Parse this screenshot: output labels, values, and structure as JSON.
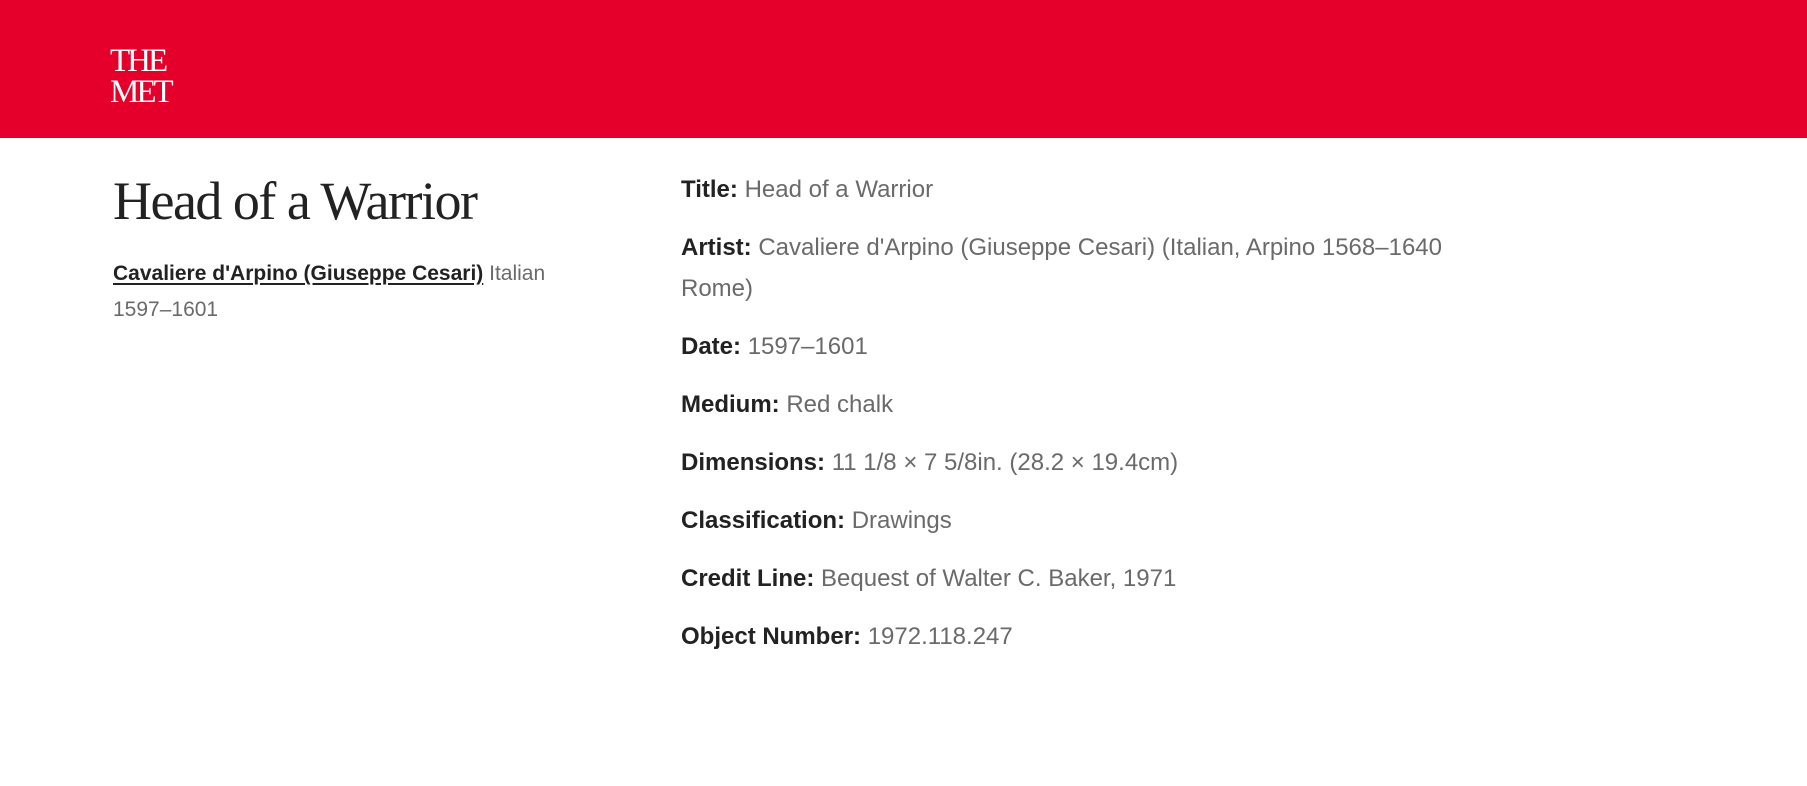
{
  "header": {
    "logo_line1": "THE",
    "logo_line2": "MET",
    "color": "#e4002b"
  },
  "object": {
    "title": "Head of a Warrior",
    "artist_link": "Cavaliere d'Arpino (Giuseppe Cesari)",
    "nationality": "Italian",
    "date": "1597–1601"
  },
  "details": [
    {
      "label": "Title:",
      "value": "Head of a Warrior"
    },
    {
      "label": "Artist:",
      "value": "Cavaliere d'Arpino (Giuseppe Cesari) (Italian, Arpino 1568–1640 Rome)"
    },
    {
      "label": "Date:",
      "value": "1597–1601"
    },
    {
      "label": "Medium:",
      "value": "Red chalk"
    },
    {
      "label": "Dimensions:",
      "value": "11 1/8 × 7 5/8in. (28.2 × 19.4cm)"
    },
    {
      "label": "Classification:",
      "value": "Drawings"
    },
    {
      "label": "Credit Line:",
      "value": "Bequest of Walter C. Baker, 1971"
    },
    {
      "label": "Object Number:",
      "value": "1972.118.247"
    }
  ]
}
